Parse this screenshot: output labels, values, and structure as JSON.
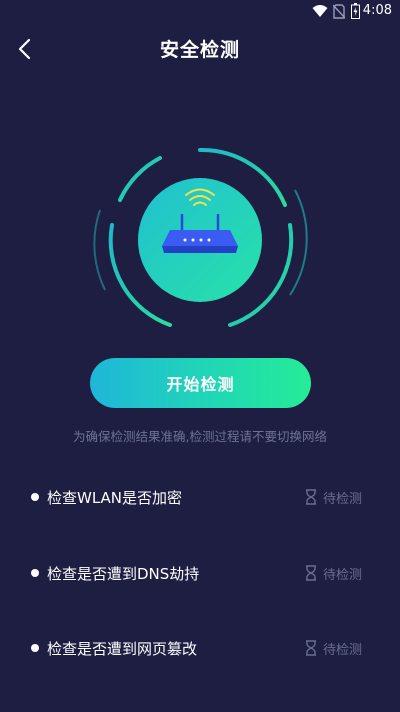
{
  "status_bar": {
    "time": "4:08"
  },
  "header": {
    "title": "安全检测"
  },
  "main": {
    "start_button_label": "开始检测",
    "hint": "为确保检测结果准确,检测过程请不要切换网络"
  },
  "checks": [
    {
      "label": "检查WLAN是否加密",
      "status": "待检测"
    },
    {
      "label": "检查是否遭到DNS劫持",
      "status": "待检测"
    },
    {
      "label": "检查是否遭到网页篡改",
      "status": "待检测"
    }
  ],
  "colors": {
    "background": "#1d1e42",
    "gradient_start": "#1fb6d9",
    "gradient_end": "#25ec97",
    "router_blue": "#3355ee",
    "muted_text": "#6e7196"
  },
  "icons": [
    "back-arrow-icon",
    "router-icon",
    "wifi-signal-icon",
    "hourglass-icon"
  ]
}
